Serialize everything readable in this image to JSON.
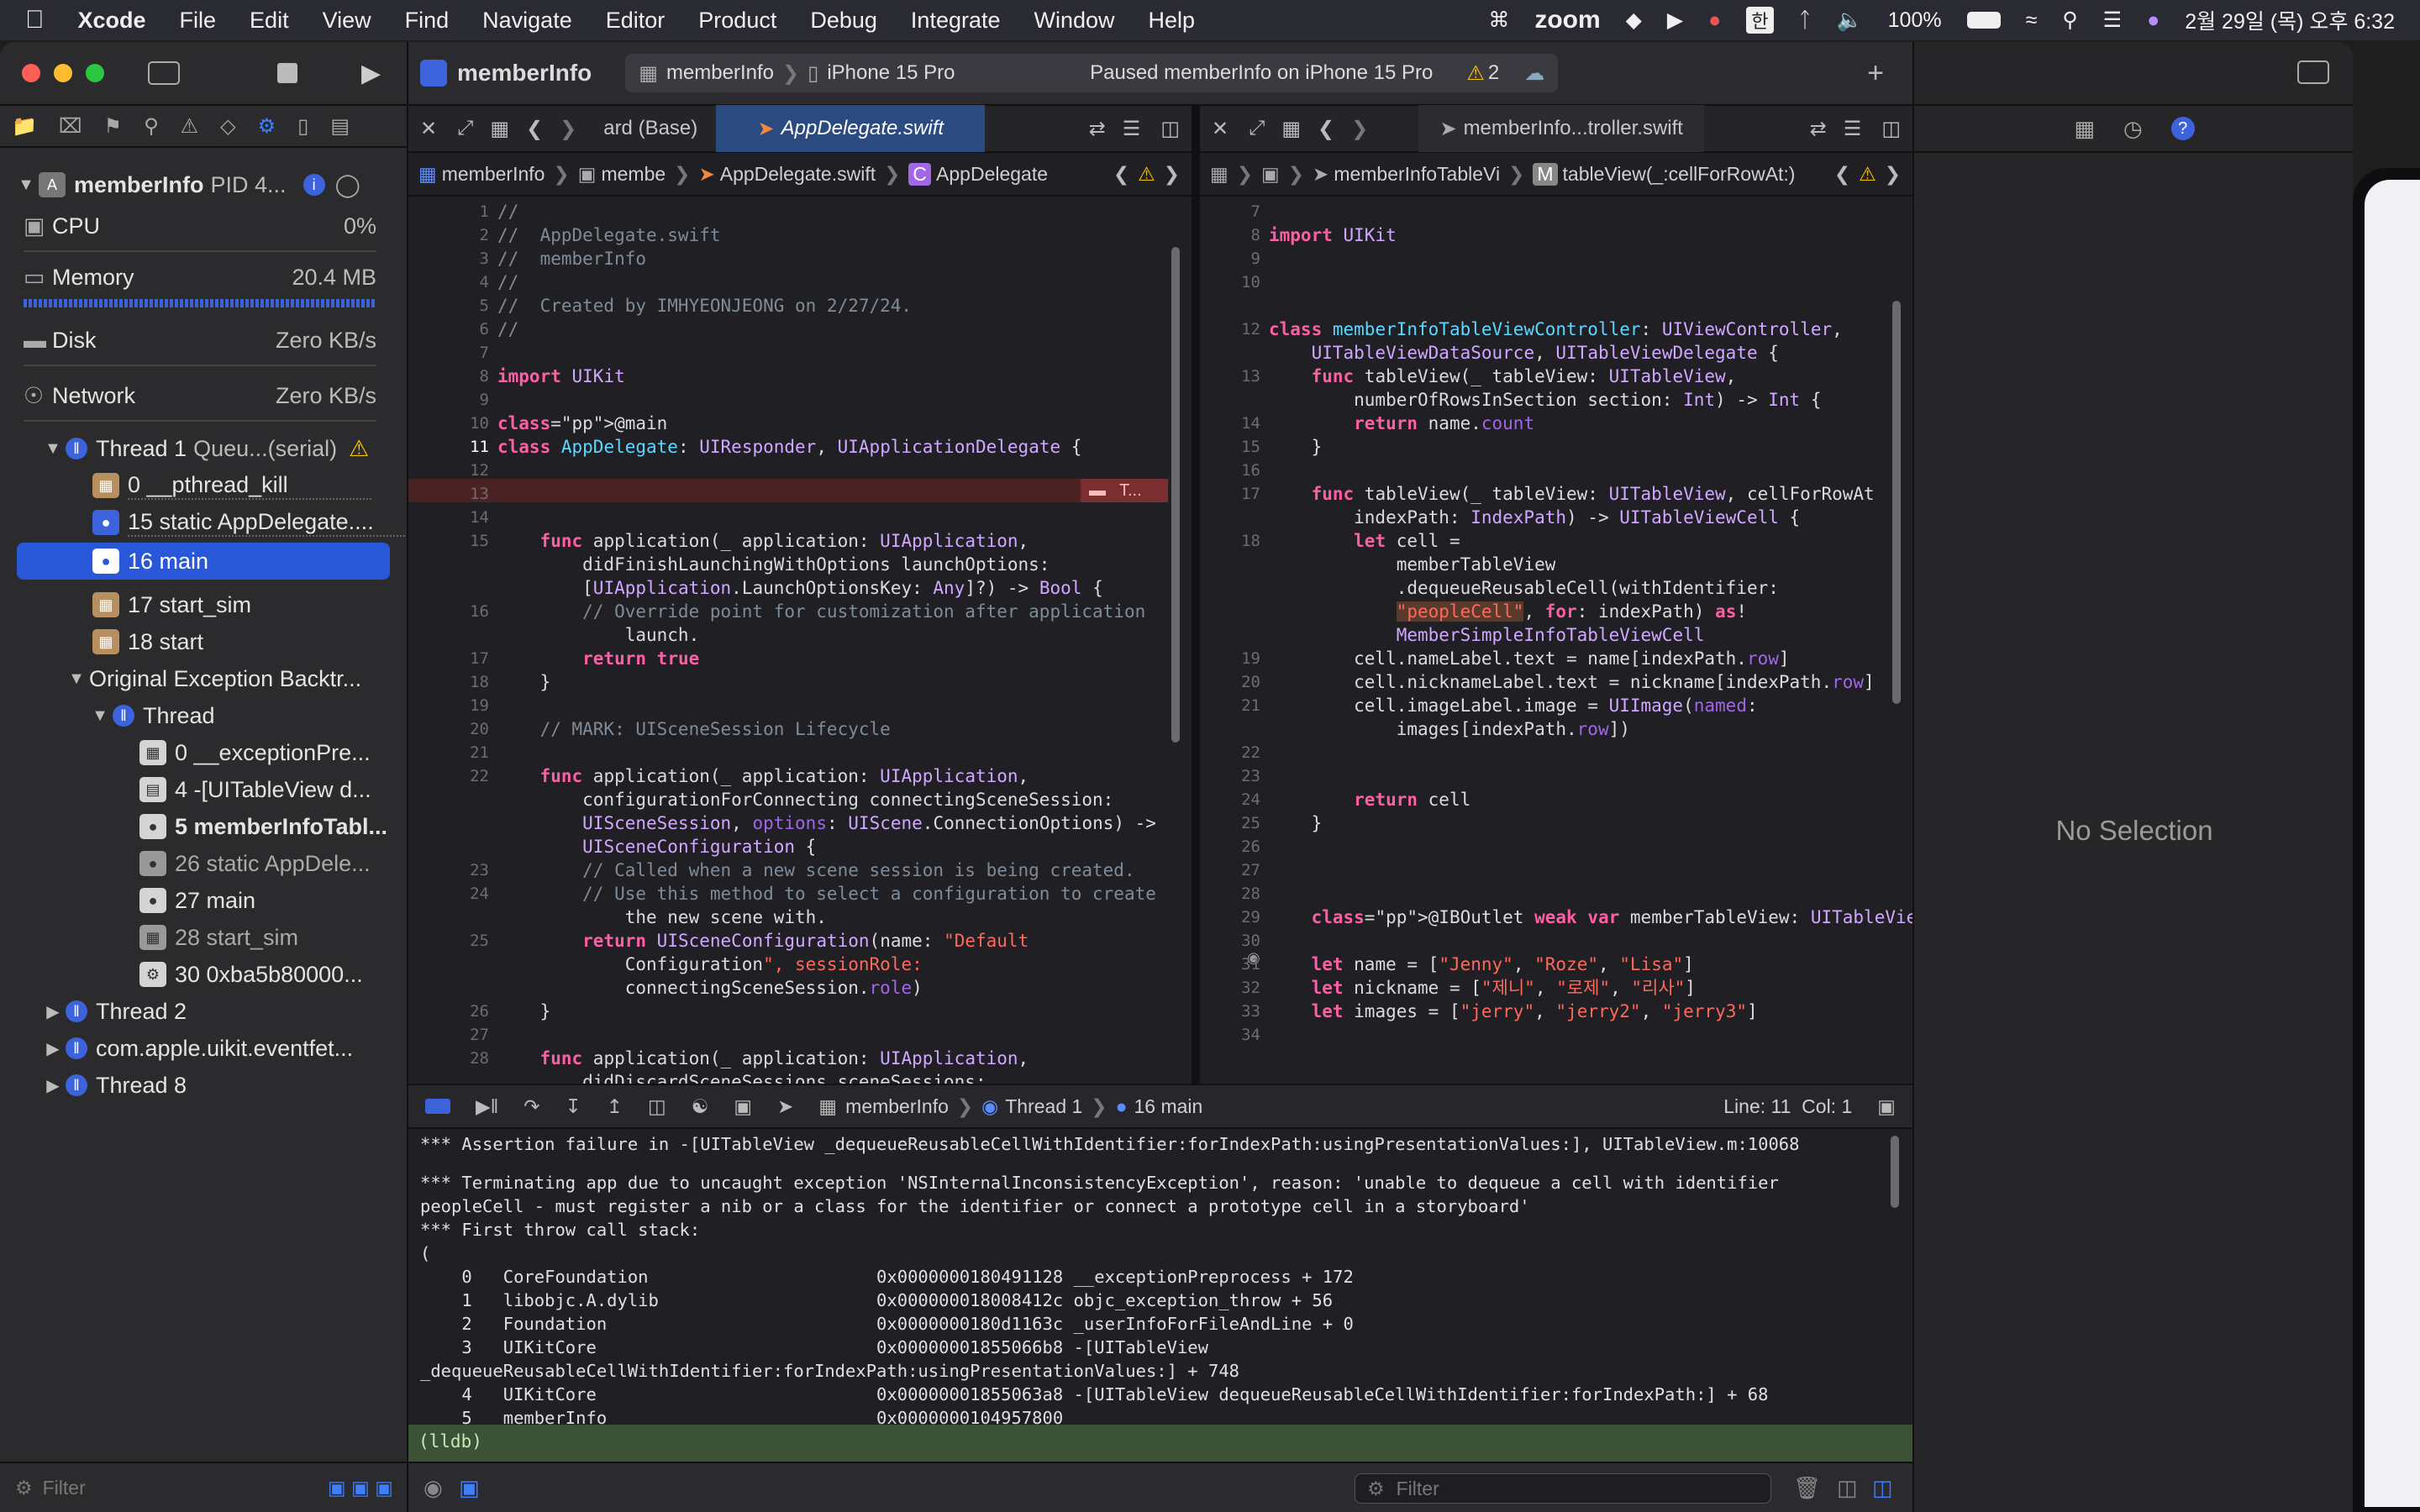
{
  "menubar": {
    "app": "Xcode",
    "items": [
      "File",
      "Edit",
      "View",
      "Find",
      "Navigate",
      "Editor",
      "Product",
      "Debug",
      "Integrate",
      "Window",
      "Help"
    ],
    "zoom": "zoom",
    "input_lang": "한",
    "battery": "100%",
    "datetime": "2월 29일 (목) 오후 6:32"
  },
  "toolbar": {
    "project": "memberInfo",
    "scheme": "memberInfo",
    "device": "iPhone 15 Pro",
    "status": "Paused memberInfo on iPhone 15 Pro",
    "warnings": "2"
  },
  "navigator": {
    "process": "memberInfo",
    "pid": "PID 4...",
    "stats": [
      {
        "label": "CPU",
        "value": "0%"
      },
      {
        "label": "Memory",
        "value": "20.4 MB"
      },
      {
        "label": "Disk",
        "value": "Zero KB/s"
      },
      {
        "label": "Network",
        "value": "Zero KB/s"
      }
    ],
    "thread1": "Thread 1",
    "thread1_queue": "Queu...(serial)",
    "frames1": [
      "0 __pthread_kill",
      "15 static AppDelegate....",
      "16 main",
      "17 start_sim",
      "18 start"
    ],
    "original": "Original Exception Backtr...",
    "thread": "Thread",
    "frames2": [
      "0 __exceptionPre...",
      "4 -[UITableView d...",
      "5 memberInfoTabl...",
      "26 static AppDele...",
      "27 main",
      "28 start_sim",
      "30 0xba5b80000..."
    ],
    "thread2": "Thread 2",
    "eventfetch": "com.apple.uikit.eventfet...",
    "thread8": "Thread 8",
    "filter_placeholder": "Filter"
  },
  "left_editor": {
    "tab_prev": "ard (Base)",
    "tab_active": "AppDelegate.swift",
    "jump": [
      "memberInfo",
      "membe",
      "AppDelegate.swift",
      "AppDelegate"
    ],
    "error_badge": "T...",
    "lines": [
      {
        "n": "1",
        "t": "//"
      },
      {
        "n": "2",
        "t": "//  AppDelegate.swift"
      },
      {
        "n": "3",
        "t": "//  memberInfo"
      },
      {
        "n": "4",
        "t": "//"
      },
      {
        "n": "5",
        "t": "//  Created by IMHYEONJEONG on 2/27/24."
      },
      {
        "n": "6",
        "t": "//"
      },
      {
        "n": "8",
        "t": "import UIKit"
      },
      {
        "n": "10",
        "t": "@main"
      },
      {
        "n": "11",
        "t": "class AppDelegate: UIResponder, UIApplicationDelegate {"
      },
      {
        "n": "15",
        "t": "    func application(_ application: UIApplication,"
      },
      {
        "n": "",
        "t": "        didFinishLaunchingWithOptions launchOptions:"
      },
      {
        "n": "",
        "t": "        [UIApplication.LaunchOptionsKey: Any]?) -> Bool {"
      },
      {
        "n": "16",
        "t": "        // Override point for customization after application"
      },
      {
        "n": "",
        "t": "            launch."
      },
      {
        "n": "17",
        "t": "        return true"
      },
      {
        "n": "18",
        "t": "    }"
      },
      {
        "n": "20",
        "t": "    // MARK: UISceneSession Lifecycle"
      },
      {
        "n": "22",
        "t": "    func application(_ application: UIApplication,"
      },
      {
        "n": "",
        "t": "        configurationForConnecting connectingSceneSession:"
      },
      {
        "n": "",
        "t": "        UISceneSession, options: UIScene.ConnectionOptions) ->"
      },
      {
        "n": "",
        "t": "        UISceneConfiguration {"
      },
      {
        "n": "23",
        "t": "        // Called when a new scene session is being created."
      },
      {
        "n": "24",
        "t": "        // Use this method to select a configuration to create"
      },
      {
        "n": "",
        "t": "            the new scene with."
      },
      {
        "n": "25",
        "t": "        return UISceneConfiguration(name: \"Default"
      },
      {
        "n": "",
        "t": "            Configuration\", sessionRole:"
      },
      {
        "n": "",
        "t": "            connectingSceneSession.role)"
      },
      {
        "n": "26",
        "t": "    }"
      },
      {
        "n": "28",
        "t": "    func application(_ application: UIApplication,"
      },
      {
        "n": "",
        "t": "        didDiscardSceneSessions sceneSessions:"
      }
    ]
  },
  "right_editor": {
    "tab": "memberInfo...troller.swift",
    "jump": [
      "memberInfoTableVi",
      "tableView(_:cellForRowAt:)"
    ],
    "lines": [
      {
        "n": "8",
        "t": "import UIKit"
      },
      {
        "n": "12",
        "t": "class memberInfoTableViewController: UIViewController,"
      },
      {
        "n": "",
        "t": "    UITableViewDataSource, UITableViewDelegate {"
      },
      {
        "n": "13",
        "t": "    func tableView(_ tableView: UITableView,"
      },
      {
        "n": "",
        "t": "        numberOfRowsInSection section: Int) -> Int {"
      },
      {
        "n": "14",
        "t": "        return name.count"
      },
      {
        "n": "15",
        "t": "    }"
      },
      {
        "n": "17",
        "t": "    func tableView(_ tableView: UITableView, cellForRowAt"
      },
      {
        "n": "",
        "t": "        indexPath: IndexPath) -> UITableViewCell {"
      },
      {
        "n": "18",
        "t": "        let cell ="
      },
      {
        "n": "",
        "t": "            memberTableView"
      },
      {
        "n": "",
        "t": "            .dequeueReusableCell(withIdentifier:"
      },
      {
        "n": "",
        "t": "            \"peopleCell\", for: indexPath) as!"
      },
      {
        "n": "",
        "t": "            MemberSimpleInfoTableViewCell"
      },
      {
        "n": "19",
        "t": "        cell.nameLabel.text = name[indexPath.row]"
      },
      {
        "n": "20",
        "t": "        cell.nicknameLabel.text = nickname[indexPath.row]"
      },
      {
        "n": "21",
        "t": "        cell.imageLabel.image = UIImage(named:"
      },
      {
        "n": "",
        "t": "            images[indexPath.row])"
      },
      {
        "n": "24",
        "t": "        return cell"
      },
      {
        "n": "25",
        "t": "    }"
      },
      {
        "n": "29",
        "t": "    @IBOutlet weak var memberTableView: UITableView!"
      },
      {
        "n": "31",
        "t": "    let name = [\"Jenny\", \"Roze\", \"Lisa\"]"
      },
      {
        "n": "32",
        "t": "    let nickname = [\"제니\", \"로제\", \"리사\"]"
      },
      {
        "n": "33",
        "t": "    let images = [\"jerry\", \"jerry2\", \"jerry3\"]"
      }
    ]
  },
  "debugbar": {
    "crumbs": [
      "memberInfo",
      "Thread 1",
      "16 main"
    ],
    "position": "Line: 11  Col: 1"
  },
  "console": {
    "lines": [
      "*** Assertion failure in -[UITableView _dequeueReusableCellWithIdentifier:forIndexPath:usingPresentationValues:], UITableView.m:10068",
      "*** Terminating app due to uncaught exception 'NSInternalInconsistencyException', reason: 'unable to dequeue a cell with identifier",
      "peopleCell - must register a nib or a class for the identifier or connect a prototype cell in a storyboard'",
      "*** First throw call stack:",
      "(",
      "    0   CoreFoundation                      0x0000000180491128 __exceptionPreprocess + 172",
      "    1   libobjc.A.dylib                     0x000000018008412c objc_exception_throw + 56",
      "    2   Foundation                          0x0000000180d1163c _userInfoForFileAndLine + 0",
      "    3   UIKitCore                           0x00000001855066b8 -[UITableView",
      "_dequeueReusableCellWithIdentifier:forIndexPath:usingPresentationValues:] + 748",
      "    4   UIKitCore                           0x00000001855063a8 -[UITableView dequeueReusableCellWithIdentifier:forIndexPath:] + 68",
      "    5   memberInfo                          0x0000000104957800"
    ],
    "prompt": "(lldb)",
    "filter_placeholder": "Filter"
  },
  "inspector": {
    "empty": "No Selection"
  },
  "colors": {
    "accent": "#2858d8",
    "error_line": "#4a2224",
    "lldb": "#3c5236"
  }
}
